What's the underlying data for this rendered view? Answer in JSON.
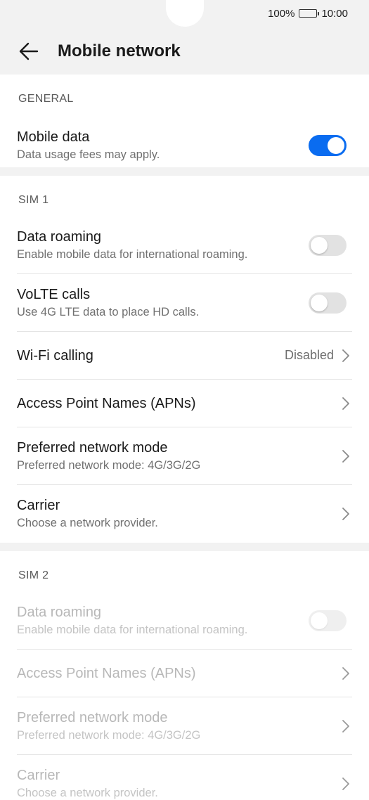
{
  "status_bar": {
    "battery_percent": "100%",
    "time": "10:00"
  },
  "header": {
    "title": "Mobile network"
  },
  "general": {
    "label": "GENERAL",
    "mobile_data": {
      "title": "Mobile data",
      "subtitle": "Data usage fees may apply.",
      "enabled": true
    }
  },
  "sim1": {
    "label": "SIM 1",
    "data_roaming": {
      "title": "Data roaming",
      "subtitle": "Enable mobile data for international roaming.",
      "enabled": false
    },
    "volte": {
      "title": "VoLTE calls",
      "subtitle": "Use 4G LTE data to place HD calls.",
      "enabled": false
    },
    "wifi_calling": {
      "title": "Wi-Fi calling",
      "value": "Disabled"
    },
    "apn": {
      "title": "Access Point Names (APNs)"
    },
    "network_mode": {
      "title": "Preferred network mode",
      "subtitle": "Preferred network mode: 4G/3G/2G"
    },
    "carrier": {
      "title": "Carrier",
      "subtitle": "Choose a network provider."
    }
  },
  "sim2": {
    "label": "SIM 2",
    "data_roaming": {
      "title": "Data roaming",
      "subtitle": "Enable mobile data for international roaming.",
      "enabled": false
    },
    "apn": {
      "title": "Access Point Names (APNs)"
    },
    "network_mode": {
      "title": "Preferred network mode",
      "subtitle": "Preferred network mode: 4G/3G/2G"
    },
    "carrier": {
      "title": "Carrier",
      "subtitle": "Choose a network provider."
    }
  },
  "colors": {
    "accent": "#0a6cf0",
    "background": "#f2f2f2",
    "disabled_text": "#b8b8b8"
  }
}
